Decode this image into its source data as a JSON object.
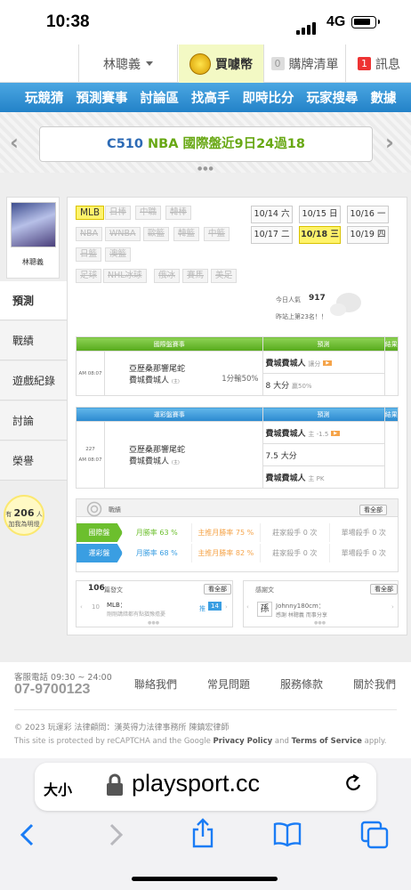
{
  "status": {
    "time": "10:38",
    "network": "4G"
  },
  "topnav": {
    "username": "林聰義",
    "buy_label": "買噱幣",
    "cart_count": "0",
    "cart_label": "購牌清單",
    "msg_count": "1",
    "msg_label": "訊息"
  },
  "menu": [
    "玩競猜",
    "預測賽事",
    "討論區",
    "找高手",
    "即時比分",
    "玩家搜尋",
    "數據"
  ],
  "banner": {
    "code": "C510",
    "text": "NBA 國際盤近9日24過18"
  },
  "profile": {
    "name": "林聰義"
  },
  "sidebar": [
    "預測",
    "戰績",
    "遊戲紀錄",
    "討論",
    "榮譽"
  ],
  "hint": {
    "prefix": "有",
    "count": "206",
    "unit": "人",
    "line2": "加我為明燈"
  },
  "leagues": [
    [
      "MLB",
      "日棒",
      "中職",
      "韓棒"
    ],
    [
      "NBA",
      "WNBA",
      "歐籃",
      "韓籃",
      "中籃"
    ],
    [
      "日籃",
      "澳籃"
    ],
    [
      "足球",
      "NHL冰球",
      "俄冰",
      "賽馬",
      "美足"
    ]
  ],
  "dates": [
    [
      "10/14 六",
      "10/15 日",
      "10/16 一"
    ],
    [
      "10/17 二",
      "10/18 三",
      "10/19 四"
    ]
  ],
  "popularity": {
    "label": "今日人氣",
    "value": "917",
    "rank": "昨站上第23名！！"
  },
  "intl": {
    "headers": [
      "國際盤賽事",
      "預測",
      "結果"
    ],
    "time": "AM 08:07",
    "team1": "亞歷桑那響尾蛇",
    "team2": "費城費城人",
    "team2_tag": "(主)",
    "line": "1分輸50%",
    "pick1": "費城費城人",
    "pick1_note": "讓分",
    "pick2": "8 大分",
    "pick2_note": "贏50%"
  },
  "lottery": {
    "headers": [
      "運彩盤賽事",
      "預測",
      "結果"
    ],
    "num": "227",
    "time": "AM 08:07",
    "team1": "亞歷桑那響尾蛇",
    "team2": "費城費城人",
    "team2_tag": "(主)",
    "pick1": "費城費城人",
    "pick1_note": "主 -1.5",
    "pick2": "7.5 大分",
    "pick3": "費城費城人",
    "pick3_note": "主 PK"
  },
  "stats": {
    "title": "戰績",
    "more": "看全部",
    "rows": [
      {
        "label": "國際盤",
        "monthly": "月勝率 63 %",
        "home": "主推月勝率 75 %",
        "banker": "莊家殺手 0 次",
        "single": "單場殺手 0 次"
      },
      {
        "label": "運彩盤",
        "monthly": "月勝率 68 %",
        "home": "主推月勝率 82 %",
        "banker": "莊家殺手 0 次",
        "single": "單場殺手 0 次"
      }
    ]
  },
  "articles": {
    "count": "106",
    "label": "篇發文",
    "more": "看全部",
    "item_num": "10",
    "item_title": "MLB：",
    "item_sub": "剛剛講錯都有點猶豫擔憂",
    "item_tag": "推",
    "item_count": "14"
  },
  "reviews": {
    "label": "感謝文",
    "more": "看全部",
    "avatar_char": "孫",
    "user": "Johnny180cm：",
    "text": "感謝 林聰義 而事分享"
  },
  "footer": {
    "hours_label": "客服電話 09:30 ~ 24:00",
    "phone": "07-9700123",
    "links": [
      "聯絡我們",
      "常見問題",
      "服務條款",
      "關於我們"
    ],
    "copyright": "© 2023 玩運彩 法律顧問：漢英得力法律事務所 陳鎮宏律師",
    "recaptcha_pre": "This site is protected by reCAPTCHA and the Google",
    "privacy": "Privacy Policy",
    "and": "and",
    "terms": "Terms of Service",
    "apply": "apply."
  },
  "safari": {
    "text_size": "大小",
    "url": "playsport.cc"
  }
}
